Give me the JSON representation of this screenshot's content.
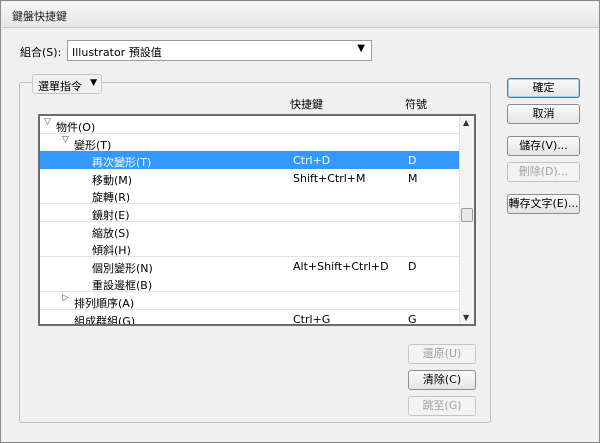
{
  "window": {
    "title": "鍵盤快捷鍵"
  },
  "set": {
    "label": "組合(S):",
    "value": "Illustrator 預設值",
    "arrow": "▼"
  },
  "category": {
    "value": "選單指令",
    "arrow": "▼"
  },
  "columns": {
    "shortcut": "快捷鍵",
    "symbol": "符號"
  },
  "rows": [
    {
      "twisty": "▽",
      "name": "物件(O)",
      "shortcut": "",
      "symbol": ""
    },
    {
      "twisty": "▽",
      "name": "變形(T)",
      "shortcut": "",
      "symbol": ""
    },
    {
      "twisty": "",
      "name": "再次變形(T)",
      "shortcut": "Ctrl+D",
      "symbol": "D",
      "selected": true
    },
    {
      "twisty": "",
      "name": "移動(M)",
      "shortcut": "Shift+Ctrl+M",
      "symbol": "M"
    },
    {
      "twisty": "",
      "name": "旋轉(R)",
      "shortcut": "",
      "symbol": ""
    },
    {
      "twisty": "",
      "name": "鏡射(E)",
      "shortcut": "",
      "symbol": ""
    },
    {
      "twisty": "",
      "name": "縮放(S)",
      "shortcut": "",
      "symbol": ""
    },
    {
      "twisty": "",
      "name": "傾斜(H)",
      "shortcut": "",
      "symbol": ""
    },
    {
      "twisty": "",
      "name": "個別變形(N)",
      "shortcut": "Alt+Shift+Ctrl+D",
      "symbol": "D"
    },
    {
      "twisty": "",
      "name": "重設邊框(B)",
      "shortcut": "",
      "symbol": ""
    },
    {
      "twisty": "▷",
      "name": "排列順序(A)",
      "shortcut": "",
      "symbol": ""
    },
    {
      "twisty": "",
      "name": "組成群組(G)",
      "shortcut": "Ctrl+G",
      "symbol": "G"
    }
  ],
  "scrollbar": {
    "up": "▲",
    "down": "▼"
  },
  "buttons": {
    "ok": "確定",
    "cancel": "取消",
    "save": "儲存(V)...",
    "delete": "刪除(D)...",
    "export_text": "轉存文字(E)...",
    "undo": "還原(U)",
    "clear": "清除(C)",
    "goto": "跳至(G)"
  }
}
